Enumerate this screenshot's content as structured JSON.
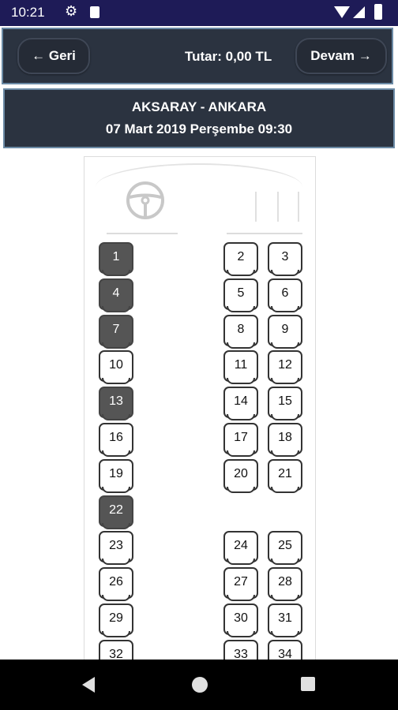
{
  "status_bar": {
    "time": "10:21",
    "icons": [
      "gear-icon",
      "sd-card-icon",
      "wifi-icon",
      "signal-icon",
      "battery-icon"
    ]
  },
  "topbar": {
    "back_label": "← Geri",
    "amount_label": "Tutar: 0,00 TL",
    "next_label": "Devam →"
  },
  "route": {
    "title": "AKSARAY - ANKARA",
    "datetime": "07 Mart 2019 Perşembe 09:30"
  },
  "seats": {
    "s1": "1",
    "s2": "2",
    "s3": "3",
    "s4": "4",
    "s5": "5",
    "s6": "6",
    "s7": "7",
    "s8": "8",
    "s9": "9",
    "s10": "10",
    "s11": "11",
    "s12": "12",
    "s13": "13",
    "s14": "14",
    "s15": "15",
    "s16": "16",
    "s17": "17",
    "s18": "18",
    "s19": "19",
    "s20": "20",
    "s21": "21",
    "s22": "22",
    "s23": "23",
    "s24": "24",
    "s25": "25",
    "s26": "26",
    "s27": "27",
    "s28": "28",
    "s29": "29",
    "s30": "30",
    "s31": "31",
    "s32": "32",
    "s33": "33",
    "s34": "34"
  },
  "taken_seats": [
    "1",
    "4",
    "7",
    "13",
    "22"
  ],
  "colors": {
    "status_bar": "#1e1b57",
    "header_bg": "#2b3340",
    "header_border": "#6b8aa5",
    "seat_taken": "#555555",
    "seat_free": "#ffffff"
  }
}
